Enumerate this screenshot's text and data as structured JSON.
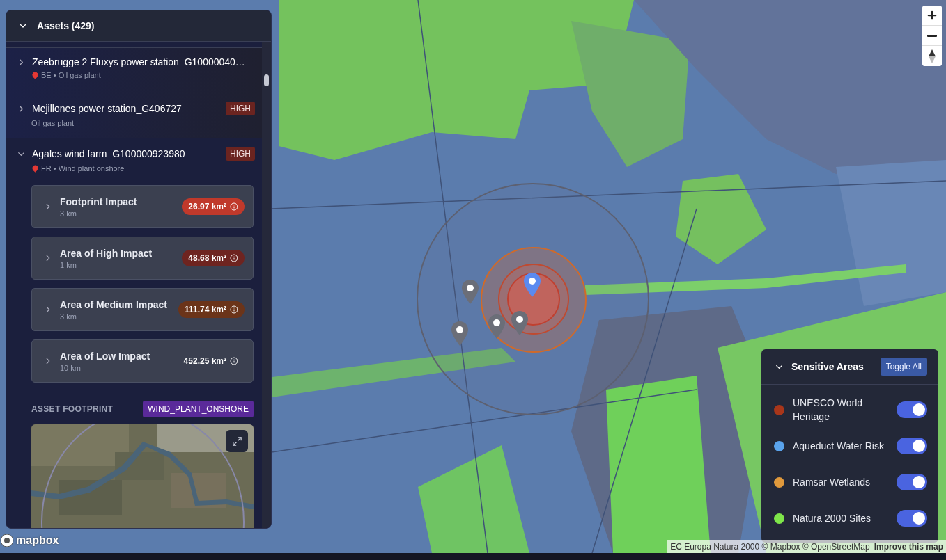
{
  "assets_panel": {
    "title": "Assets (429)",
    "expanded": true,
    "items": [
      {
        "name": "Zeebrugge 2 Fluxys power station_G10000040…",
        "subtitle": "BE • Oil gas plant",
        "pin": true,
        "expanded": false
      },
      {
        "name": "Mejillones power station_G406727",
        "subtitle": "Oil gas plant",
        "pin": false,
        "expanded": false,
        "badge": "HIGH"
      },
      {
        "name": "Agales wind farm_G100000923980",
        "subtitle": "FR • Wind plant onshore",
        "pin": true,
        "expanded": true,
        "badge": "HIGH",
        "impacts": [
          {
            "title": "Footprint Impact",
            "distance": "3 km",
            "area": "26.97 km²",
            "color": "#c0392b"
          },
          {
            "title": "Area of High Impact",
            "distance": "1 km",
            "area": "48.68 km²",
            "color": "#6e2420"
          },
          {
            "title": "Area of Medium Impact",
            "distance": "3 km",
            "area": "111.74 km²",
            "color": "#6b3419"
          },
          {
            "title": "Area of Low Impact",
            "distance": "10 km",
            "area": "452.25 km²"
          }
        ],
        "footprint": {
          "label": "ASSET FOOTPRINT",
          "type": "WIND_PLANT_ONSHORE",
          "kind": "picture"
        }
      }
    ]
  },
  "sensitive_areas": {
    "title": "Sensitive Areas",
    "expanded": true,
    "toggle_all": "Toggle All",
    "layers": [
      {
        "label": "UNESCO World Heritage",
        "color": "#a8361a",
        "on": true
      },
      {
        "label": "Aqueduct Water Risk",
        "color": "#5aa3ec",
        "on": true
      },
      {
        "label": "Ramsar Wetlands",
        "color": "#e0993c",
        "on": true
      },
      {
        "label": "Natura 2000 Sites",
        "color": "#7ee54a",
        "on": true
      }
    ]
  },
  "attribution": {
    "text": "EC Europa Natura 2000 © Mapbox © OpenStreetMap",
    "link": "Improve this map"
  },
  "logo": "mapbox"
}
